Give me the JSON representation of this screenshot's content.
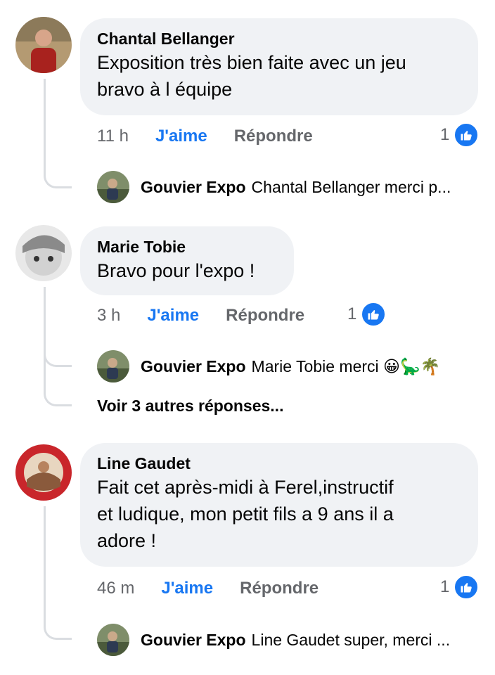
{
  "comments": [
    {
      "author": "Chantal Bellanger",
      "text_lines": [
        "Exposition très bien faite avec un jeu",
        "bravo à l équipe"
      ],
      "time": "11 h",
      "like_label": "J'aime",
      "reply_label": "Répondre",
      "reactions": "1",
      "reply": {
        "author": "Gouvier Expo",
        "text": "Chantal Bellanger merci p..."
      }
    },
    {
      "author": "Marie Tobie",
      "text_lines": [
        "Bravo pour l'expo !"
      ],
      "time": "3 h",
      "like_label": "J'aime",
      "reply_label": "Répondre",
      "reactions": "1",
      "reply": {
        "author": "Gouvier Expo",
        "text": "Marie Tobie merci 😀🦕🌴"
      },
      "more_replies": "Voir 3 autres réponses..."
    },
    {
      "author": "Line Gaudet",
      "text_lines": [
        "Fait cet après-midi à Ferel,instructif",
        "et ludique, mon petit fils a 9 ans il a",
        "adore !"
      ],
      "time": "46 m",
      "like_label": "J'aime",
      "reply_label": "Répondre",
      "reactions": "1",
      "reply": {
        "author": "Gouvier Expo",
        "text": "Line Gaudet super, merci ..."
      }
    }
  ],
  "icons": {
    "reaction": "like-thumb-icon"
  },
  "colors": {
    "accent": "#1877f2",
    "bubble": "#f0f2f5",
    "muted": "#65676b"
  }
}
